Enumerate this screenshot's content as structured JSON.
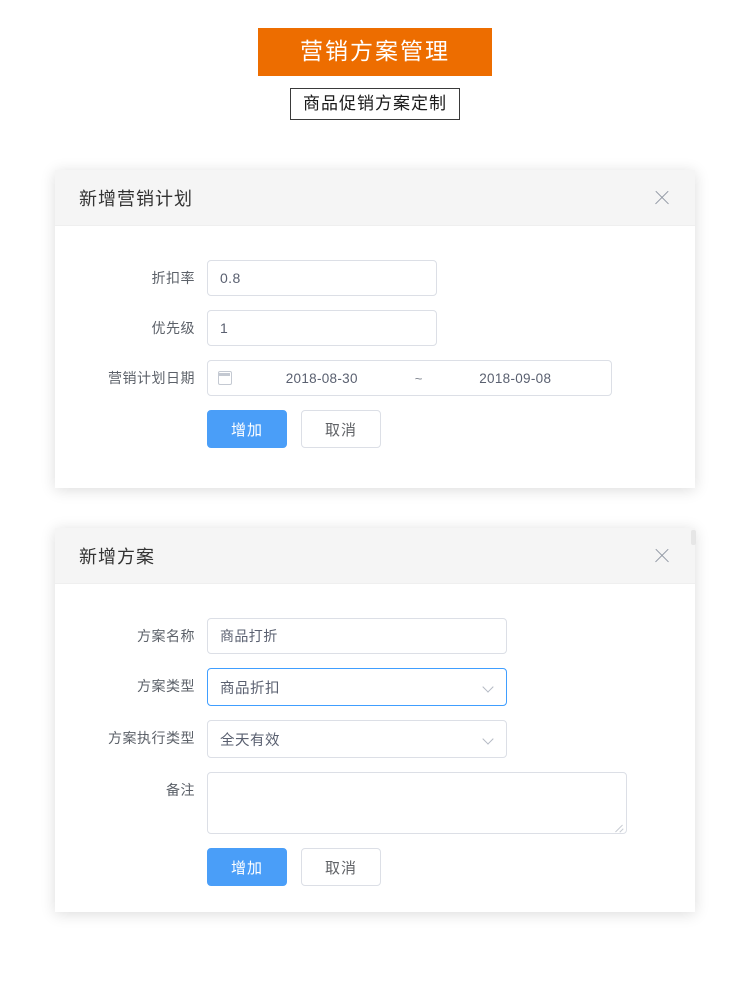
{
  "header": {
    "banner_title": "营销方案管理",
    "subtitle": "商品促销方案定制"
  },
  "dialogs": [
    {
      "id": "plan",
      "title": "新增营销计划",
      "close_icon": "close-icon",
      "fields": [
        {
          "label": "折扣率",
          "value": "0.8",
          "type": "input"
        },
        {
          "label": "优先级",
          "value": "1",
          "type": "input"
        },
        {
          "label": "营销计划日期",
          "type": "daterange",
          "icon": "calendar-icon",
          "start": "2018-08-30",
          "separator": "~",
          "end": "2018-09-08"
        }
      ],
      "buttons": {
        "submit": "增加",
        "cancel": "取消"
      }
    },
    {
      "id": "scheme",
      "title": "新增方案",
      "close_icon": "close-icon",
      "fields": [
        {
          "label": "方案名称",
          "value": "商品打折",
          "type": "input"
        },
        {
          "label": "方案类型",
          "value": "商品折扣",
          "type": "select",
          "icon": "chevron-down-icon",
          "focused": true
        },
        {
          "label": "方案执行类型",
          "value": "全天有效",
          "type": "select",
          "icon": "chevron-down-icon",
          "focused": false
        },
        {
          "label": "备注",
          "value": "",
          "type": "textarea"
        }
      ],
      "buttons": {
        "submit": "增加",
        "cancel": "取消"
      }
    }
  ],
  "colors": {
    "banner_orange": "#ED6D00",
    "primary_blue": "#4A9EF8",
    "focus_border": "#409EFF",
    "border_gray": "#DCDFE6",
    "label_gray": "#5C6169"
  }
}
